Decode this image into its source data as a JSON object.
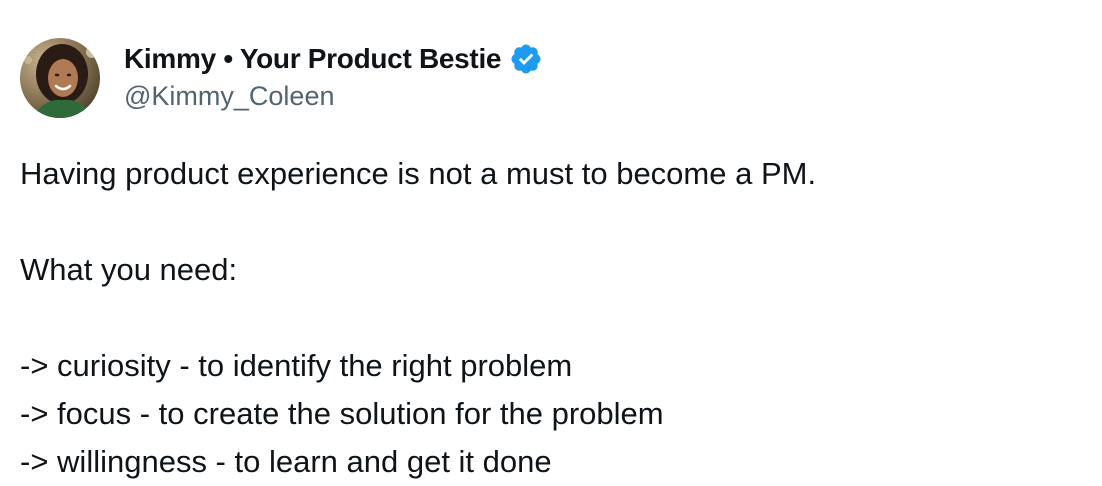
{
  "author": {
    "display_name": "Kimmy • Your Product Bestie",
    "handle": "@Kimmy_Coleen",
    "verified": true,
    "verified_color": "#1d9bf0",
    "avatar_icon": "profile-photo"
  },
  "tweet": {
    "lines": [
      "Having product experience is not a must to become a PM.",
      "",
      "What you need:",
      "",
      "-> curiosity - to identify the right problem",
      "-> focus - to create the solution for the problem",
      "-> willingness - to learn and get it done"
    ]
  },
  "colors": {
    "text_primary": "#0f1419",
    "text_secondary": "#536471",
    "background": "#ffffff"
  }
}
